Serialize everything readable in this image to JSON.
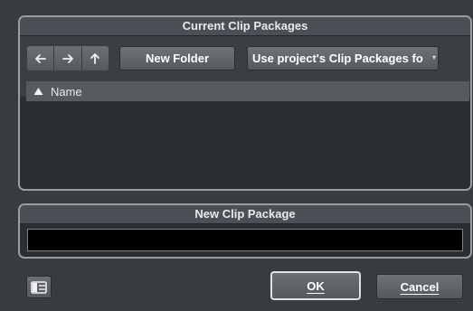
{
  "current_panel": {
    "title": "Current Clip Packages",
    "nav": {
      "back_icon": "arrow-left-icon",
      "forward_icon": "arrow-right-icon",
      "up_icon": "arrow-up-icon"
    },
    "new_folder_label": "New Folder",
    "location_select_value": "Use project's Clip Packages fo",
    "list": {
      "columns": [
        "Name"
      ],
      "sort_icon": "sort-ascending-icon",
      "rows": []
    }
  },
  "new_package_panel": {
    "title": "New Clip Package",
    "name_value": ""
  },
  "footer": {
    "layout_icon": "layout-toggle-icon",
    "ok_label": "OK",
    "cancel_label": "Cancel"
  },
  "colors": {
    "background": "#383b40",
    "panel_border": "#9a9ea3",
    "button": "#5c6065",
    "input": "#000000"
  }
}
